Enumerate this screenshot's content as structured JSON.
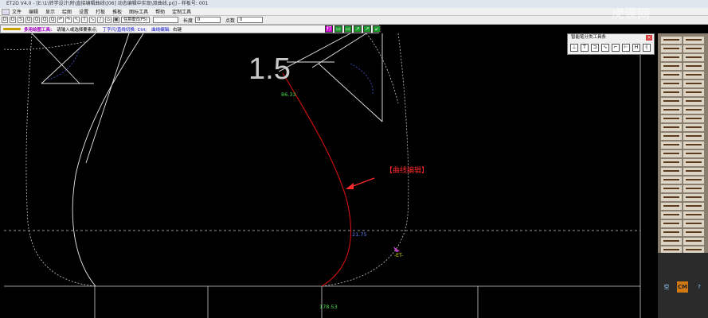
{
  "title": "ET2D V4.0 - [E:\\1\\转学设计\\附\\直接编辑曲线\\[06] 动态编辑中实现\\双曲线.prj] - 样板号: 001",
  "menu": [
    "文件",
    "编辑",
    "显示",
    "绘图",
    "设置",
    "打板",
    "推板",
    "图标工具",
    "帮助",
    "定制工具"
  ],
  "toolbar": {
    "buttons": [
      "D",
      "O",
      "S",
      "Q",
      "Q",
      "Q",
      "Q",
      "↶",
      "↷",
      "↖",
      "T",
      "∿",
      "/",
      "⌂",
      "▣"
    ],
    "mode_select": "任意模式(F5)",
    "length_label": "长度",
    "length_value": "0",
    "points_label": "点数",
    "points_value": "0"
  },
  "status": {
    "tool_name": "多用绘图工具:",
    "hint": "请输入或选择要素点;",
    "snap": "丁字尺/直线切换: Ctrl;",
    "curve_edit": "曲线编辑:",
    "curve_edit_key": "右键"
  },
  "mode_buttons": [
    "打",
    "▭",
    "▭",
    "↗",
    "↗",
    "↙"
  ],
  "float_panel": {
    "title": "智能笔分类工具条",
    "close": "×",
    "tools": [
      "⊥",
      "T",
      "⊐",
      "∿",
      "⌐",
      "⊢",
      "H",
      "┤"
    ]
  },
  "canvas": {
    "big_label": "1.5",
    "labels": [
      {
        "text": "86.33",
        "color": "#4cdc4c"
      },
      {
        "text": "21.75",
        "color": "#5a7cff"
      },
      {
        "text": "178.53",
        "color": "#4cdc4c"
      },
      {
        "text": "-ET-",
        "color": "#e0e000"
      }
    ],
    "annotation": "【曲线编辑】",
    "annotation_color": "#ff2a2a"
  },
  "right_panel": {
    "buttons": [
      "空",
      "CM",
      "?"
    ]
  },
  "watermark": "虎课网"
}
